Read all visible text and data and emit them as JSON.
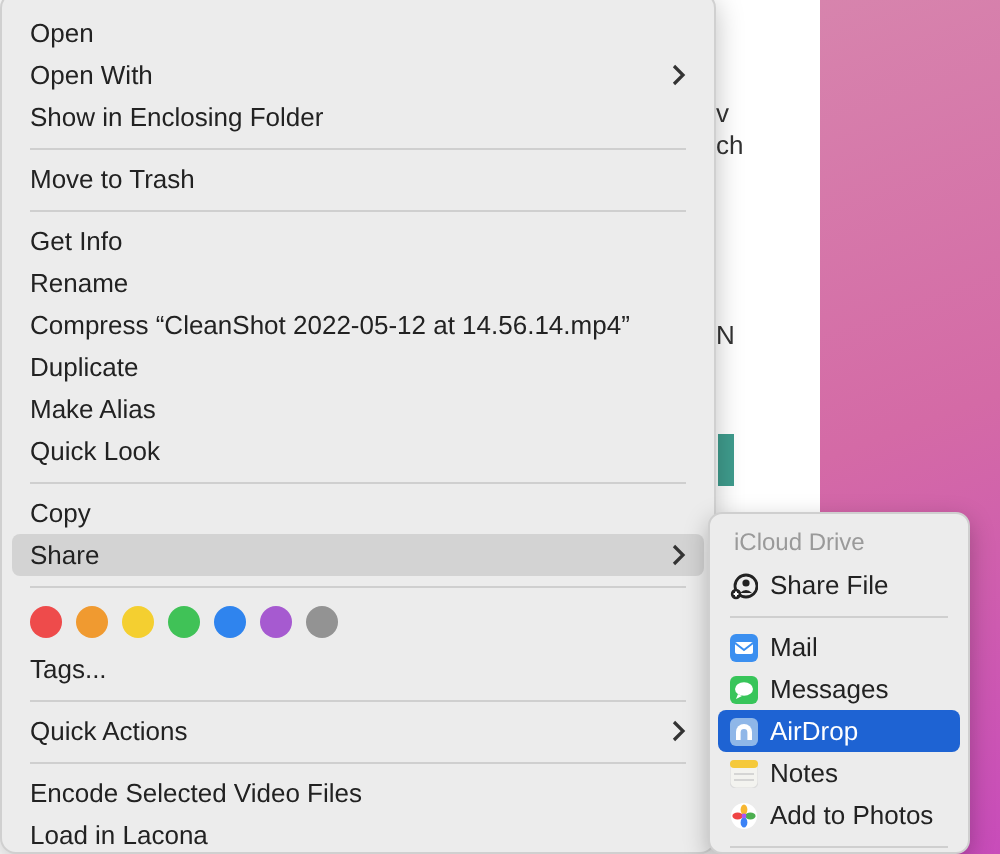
{
  "background": {
    "fragments": [
      {
        "text": "v"
      },
      {
        "text": "ch"
      },
      {
        "text": "N"
      }
    ]
  },
  "menu": {
    "items": [
      {
        "kind": "item",
        "label": "Open",
        "submenu": false,
        "selected": false
      },
      {
        "kind": "item",
        "label": "Open With",
        "submenu": true,
        "selected": false
      },
      {
        "kind": "item",
        "label": "Show in Enclosing Folder",
        "submenu": false,
        "selected": false
      },
      {
        "kind": "separator"
      },
      {
        "kind": "item",
        "label": "Move to Trash",
        "submenu": false,
        "selected": false
      },
      {
        "kind": "separator"
      },
      {
        "kind": "item",
        "label": "Get Info",
        "submenu": false,
        "selected": false
      },
      {
        "kind": "item",
        "label": "Rename",
        "submenu": false,
        "selected": false
      },
      {
        "kind": "item",
        "label": "Compress “CleanShot 2022-05-12 at 14.56.14.mp4”",
        "submenu": false,
        "selected": false
      },
      {
        "kind": "item",
        "label": "Duplicate",
        "submenu": false,
        "selected": false
      },
      {
        "kind": "item",
        "label": "Make Alias",
        "submenu": false,
        "selected": false
      },
      {
        "kind": "item",
        "label": "Quick Look",
        "submenu": false,
        "selected": false
      },
      {
        "kind": "separator"
      },
      {
        "kind": "item",
        "label": "Copy",
        "submenu": false,
        "selected": false
      },
      {
        "kind": "item",
        "label": "Share",
        "submenu": true,
        "selected": true
      },
      {
        "kind": "separator"
      },
      {
        "kind": "tags",
        "tags": [
          {
            "color": "#ee4b4b"
          },
          {
            "color": "#f09a30"
          },
          {
            "color": "#f4cf30"
          },
          {
            "color": "#40c257"
          },
          {
            "color": "#2f84ee"
          },
          {
            "color": "#a65ad0"
          },
          {
            "color": "#939393"
          }
        ]
      },
      {
        "kind": "item",
        "label": "Tags...",
        "submenu": false,
        "selected": false
      },
      {
        "kind": "separator"
      },
      {
        "kind": "item",
        "label": "Quick Actions",
        "submenu": true,
        "selected": false
      },
      {
        "kind": "separator"
      },
      {
        "kind": "item",
        "label": "Encode Selected Video Files",
        "submenu": false,
        "selected": false
      },
      {
        "kind": "item",
        "label": "Load in Lacona",
        "submenu": false,
        "selected": false
      }
    ]
  },
  "share_submenu": {
    "items": [
      {
        "kind": "header",
        "label": "iCloud Drive"
      },
      {
        "kind": "item",
        "label": "Share File",
        "selected": false
      },
      {
        "kind": "separator"
      },
      {
        "kind": "item",
        "label": "Mail",
        "selected": false
      },
      {
        "kind": "item",
        "label": "Messages",
        "selected": false
      },
      {
        "kind": "item",
        "label": "AirDrop",
        "selected": true
      },
      {
        "kind": "item",
        "label": "Notes",
        "selected": false
      },
      {
        "kind": "item",
        "label": "Add to Photos",
        "selected": false
      },
      {
        "kind": "separator"
      }
    ]
  }
}
